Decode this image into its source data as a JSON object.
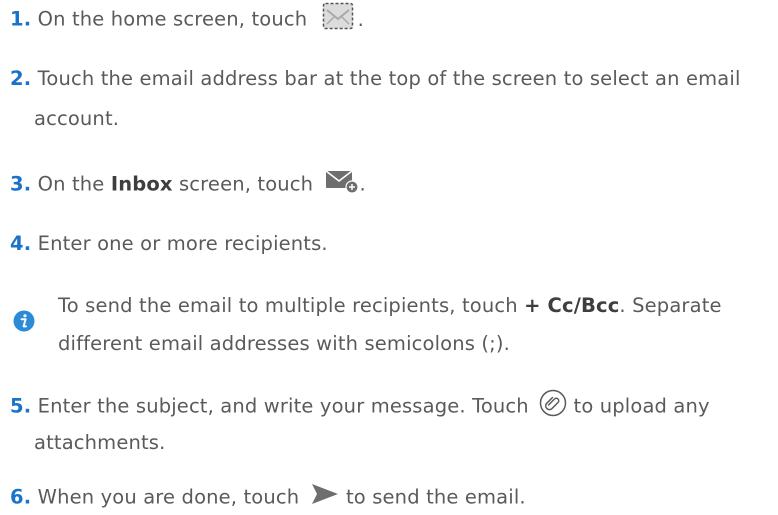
{
  "steps": {
    "s1": {
      "num": "1.",
      "text": "On the home screen, touch",
      "end": ".",
      "icon": "email-app-icon"
    },
    "s2": {
      "num": "2.",
      "line1": "Touch the email address bar at the top of the screen to select an email",
      "line2": "account."
    },
    "s3": {
      "num": "3.",
      "pre": "On the",
      "bold": "Inbox",
      "post": "screen, touch",
      "end": ".",
      "icon": "compose-email-icon"
    },
    "s4": {
      "num": "4.",
      "text": "Enter one or more recipients."
    },
    "s5": {
      "num": "5.",
      "pre": "Enter the subject, and write your message. Touch",
      "post": "to upload any",
      "line2": "attachments.",
      "icon": "paperclip-icon"
    },
    "s6": {
      "num": "6.",
      "pre": "When you are done, touch",
      "post": "to send the email.",
      "icon": "send-icon"
    }
  },
  "tip": {
    "icon": "info-icon",
    "pre": "To send the email to multiple recipients, touch",
    "bold": "+ Cc/Bcc",
    "post": ". Separate",
    "line2": "different email addresses with semicolons (;)."
  },
  "colors": {
    "accent": "#1a73c8",
    "text": "#5a5a5a"
  }
}
